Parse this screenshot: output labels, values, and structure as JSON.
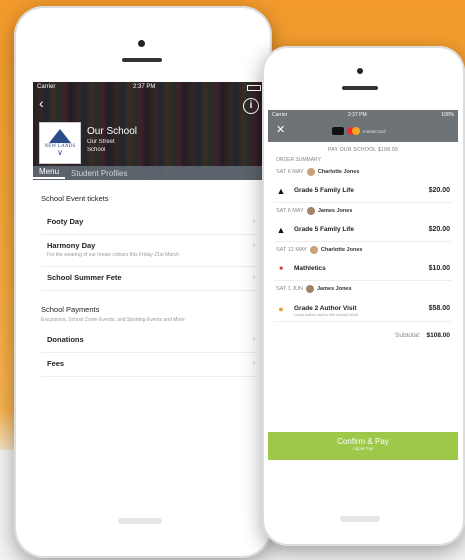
{
  "screen1": {
    "status": {
      "carrier": "Carrier",
      "time": "2:37 PM"
    },
    "school": {
      "name": "Our School",
      "street": "Our Street",
      "type": "School",
      "logo_text": "NEW LANDS"
    },
    "tabs": [
      {
        "label": "Menu"
      },
      {
        "label": "Student Profiles"
      }
    ],
    "sections": [
      {
        "title": "School Event tickets",
        "items": [
          {
            "title": "Footy Day",
            "sub": ""
          },
          {
            "title": "Harmony Day",
            "sub": "For the wearing of our house colours this Friday 21st March"
          },
          {
            "title": "School Summer Fete",
            "sub": ""
          }
        ]
      },
      {
        "title": "School Payments",
        "desc": "Excursions, School Zoom Events, and Sporting Events and More",
        "items": [
          {
            "title": "Donations",
            "sub": ""
          },
          {
            "title": "Fees",
            "sub": ""
          }
        ]
      }
    ]
  },
  "screen2": {
    "status": {
      "carrier": "Carrier",
      "time": "2:37 PM",
      "battery": "100%"
    },
    "pay_label": "mastercard",
    "subtitle": "PAY OUR SCHOOL $108.00",
    "summary_label": "ORDER SUMMARY",
    "orders": [
      {
        "date": "SAT 6 MAY",
        "person": "Charlotte Jones",
        "item": "Grade 5 Family Life",
        "sub": "",
        "price": "$20.00",
        "icon": "adidas-logo-icon"
      },
      {
        "date": "SAT 6 MAY",
        "person": "James Jones",
        "item": "Grade 5 Family Life",
        "sub": "",
        "price": "$20.00",
        "icon": "adidas-logo-icon"
      },
      {
        "date": "SAT 12 MAY",
        "person": "Charlotte Jones",
        "item": "Mathletics",
        "sub": "",
        "price": "$10.00",
        "icon": "mathletics-logo-icon"
      },
      {
        "date": "SAT 1 JUN",
        "person": "James Jones",
        "item": "Grade 2 Author Visit",
        "sub": "Local author visit to the school 2018",
        "price": "$58.00",
        "icon": "author-visit-icon"
      }
    ],
    "subtotal": {
      "label": "Subtotal:",
      "value": "$108.00"
    },
    "confirm": {
      "label": "Confirm & Pay",
      "sub": "Apple Pay"
    }
  },
  "colors": {
    "accent_green": "#9dc84a",
    "background_orange": "#f29a2c",
    "header_gray": "#6e7378"
  }
}
